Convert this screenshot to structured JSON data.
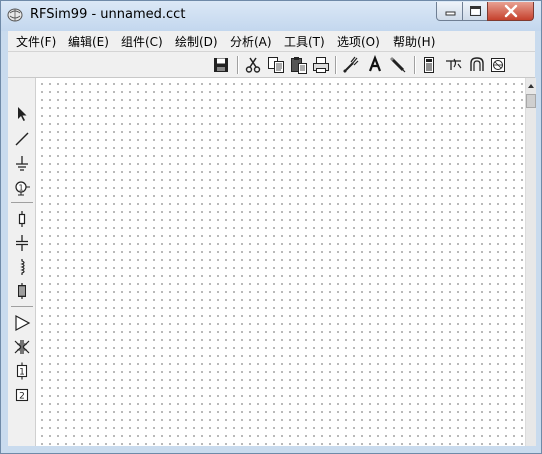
{
  "window": {
    "title": "RFSim99 - unnamed.cct",
    "controls": [
      "minimize-icon",
      "maximize-icon",
      "close-icon"
    ]
  },
  "menu": {
    "items": [
      {
        "label": "文件(F)"
      },
      {
        "label": "编辑(E)"
      },
      {
        "label": "组件(C)"
      },
      {
        "label": "绘制(D)"
      },
      {
        "label": "分析(A)"
      },
      {
        "label": "工具(T)"
      },
      {
        "label": "选项(O)"
      },
      {
        "label": "帮助(H)"
      }
    ]
  },
  "toolbar": {
    "field_value": "",
    "buttons": [
      {
        "name": "save-icon"
      },
      {
        "name": "cut-icon"
      },
      {
        "name": "copy-icon"
      },
      {
        "name": "paste-icon"
      },
      {
        "name": "print-icon"
      },
      {
        "name": "wire-tool-icon"
      },
      {
        "name": "text-tool-icon"
      },
      {
        "name": "pencil-icon"
      },
      {
        "name": "calculator-icon"
      },
      {
        "name": "transmission-line-icon"
      },
      {
        "name": "resonator-icon"
      },
      {
        "name": "smith-chart-icon"
      }
    ]
  },
  "palette": {
    "tools": [
      {
        "name": "select-arrow-icon"
      },
      {
        "name": "line-icon"
      },
      {
        "name": "ground-icon"
      },
      {
        "name": "port-icon"
      },
      {
        "name": "resistor-icon"
      },
      {
        "name": "capacitor-icon"
      },
      {
        "name": "inductor-icon"
      },
      {
        "name": "crystal-icon"
      },
      {
        "name": "amplifier-icon"
      },
      {
        "name": "transformer-icon"
      },
      {
        "name": "one-port-block-icon",
        "text": "1"
      },
      {
        "name": "two-port-block-icon",
        "text": "2"
      }
    ]
  },
  "colors": {
    "title_bar": "#c3d7ee",
    "close_button": "#c5412d",
    "chrome": "#f0f0f0",
    "grid_dot": "#7a7a7a"
  }
}
